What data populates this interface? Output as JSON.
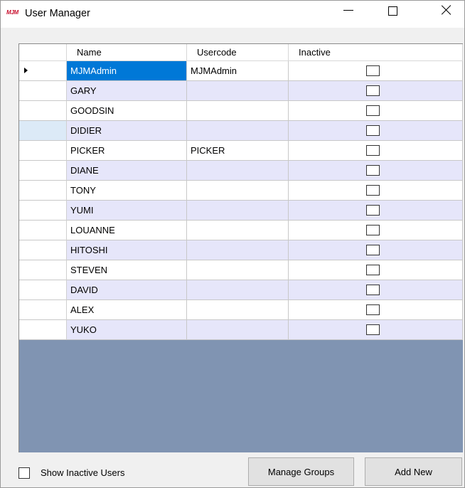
{
  "window": {
    "logo_text": "MJM",
    "title": "User Manager"
  },
  "grid": {
    "columns": [
      "Name",
      "Usercode",
      "Inactive"
    ],
    "rows": [
      {
        "name": "MJMAdmin",
        "usercode": "MJMAdmin",
        "inactive": false,
        "selected": true,
        "current": true
      },
      {
        "name": "GARY",
        "usercode": "",
        "inactive": false
      },
      {
        "name": "GOODSIN",
        "usercode": "",
        "inactive": false
      },
      {
        "name": "DIDIER",
        "usercode": "",
        "inactive": false,
        "hover": true
      },
      {
        "name": "PICKER",
        "usercode": "PICKER",
        "inactive": false
      },
      {
        "name": "DIANE",
        "usercode": "",
        "inactive": false
      },
      {
        "name": "TONY",
        "usercode": "",
        "inactive": false
      },
      {
        "name": "YUMI",
        "usercode": "",
        "inactive": false
      },
      {
        "name": "LOUANNE",
        "usercode": "",
        "inactive": false
      },
      {
        "name": "HITOSHI",
        "usercode": "",
        "inactive": false
      },
      {
        "name": "STEVEN",
        "usercode": "",
        "inactive": false
      },
      {
        "name": "DAVID",
        "usercode": "",
        "inactive": false
      },
      {
        "name": "ALEX",
        "usercode": "",
        "inactive": false
      },
      {
        "name": "YUKO",
        "usercode": "",
        "inactive": false
      }
    ]
  },
  "footer": {
    "show_inactive_label": "Show Inactive Users",
    "show_inactive_checked": false,
    "manage_groups_label": "Manage Groups",
    "add_new_label": "Add New"
  },
  "colors": {
    "selection": "#0078d7",
    "alt_row": "#e6e6fa",
    "grid_background": "#8094b2",
    "logo": "#c8102e"
  }
}
